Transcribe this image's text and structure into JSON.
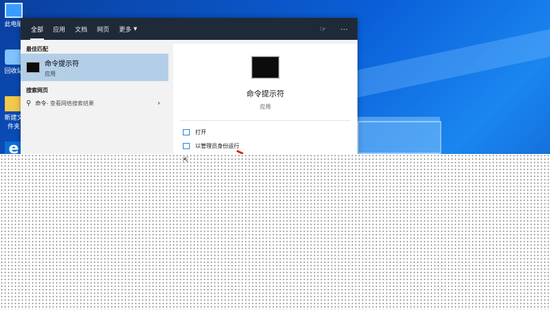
{
  "desktop": {
    "icons": [
      "此电脑",
      "回收站",
      "新建文件夹",
      "Microsoft Edge"
    ]
  },
  "tabs": [
    {
      "label": "全部",
      "active": true
    },
    {
      "label": "应用"
    },
    {
      "label": "文档"
    },
    {
      "label": "网页"
    },
    {
      "label": "更多"
    }
  ],
  "best_match": {
    "section": "最佳匹配",
    "name": "命令提示符",
    "type": "应用"
  },
  "web": {
    "section": "搜索网页",
    "query": "命令",
    "suffix": " - 查看网络搜索结果"
  },
  "detail": {
    "name": "命令提示符",
    "type": "应用",
    "actions": [
      "打开",
      "以管理员身份运行"
    ]
  },
  "colors": {
    "topbar": "#1f2a38",
    "selected": "#b3cfe8",
    "accent": "#2d7dd2"
  }
}
